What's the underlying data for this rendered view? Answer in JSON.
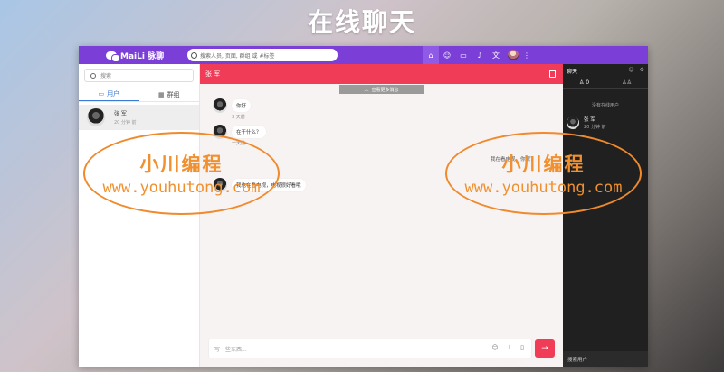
{
  "banner": {
    "title": "在线聊天"
  },
  "topbar": {
    "brand": "MaiLi 脉聊",
    "search_placeholder": "搜索人员, 页面, 群组 或 #标签",
    "icons": [
      "home-icon",
      "add-user-icon",
      "chat-icon",
      "notification-icon",
      "translate-icon",
      "avatar",
      "more-icon"
    ],
    "lang_label": "文"
  },
  "sidebar": {
    "search_placeholder": "搜索",
    "tabs": [
      {
        "label": "用户",
        "icon": "chat-icon"
      },
      {
        "label": "群组",
        "icon": "grid-icon"
      }
    ],
    "users": [
      {
        "name": "张 军",
        "time": "20 分钟 前"
      }
    ]
  },
  "chat": {
    "title": "张 军",
    "load_more": "查看更多消息",
    "messages": [
      {
        "text": "你好",
        "time": "3 天前"
      },
      {
        "text": "在干什么？",
        "time": "一天前"
      },
      {
        "text": "我也在看电视，电视很好看哦",
        "time": ""
      }
    ],
    "sent": {
      "text": "我在看电视，你呢？"
    },
    "composer_placeholder": "写一些东西...",
    "send_icon": "arrow-right-icon"
  },
  "right_panel": {
    "title": "聊天",
    "tab_online_count": "0",
    "no_online": "没有在线用户",
    "users": [
      {
        "name": "张 军",
        "time": "20 分钟 前"
      }
    ],
    "search_label": "搜索用户"
  },
  "watermark": {
    "cn": "小川编程",
    "url": "www.youhutong.com"
  },
  "colors": {
    "topbar": "#7b3fd8",
    "chat_header": "#f03c56",
    "right_panel": "#202020",
    "watermark": "#f08a2c"
  }
}
